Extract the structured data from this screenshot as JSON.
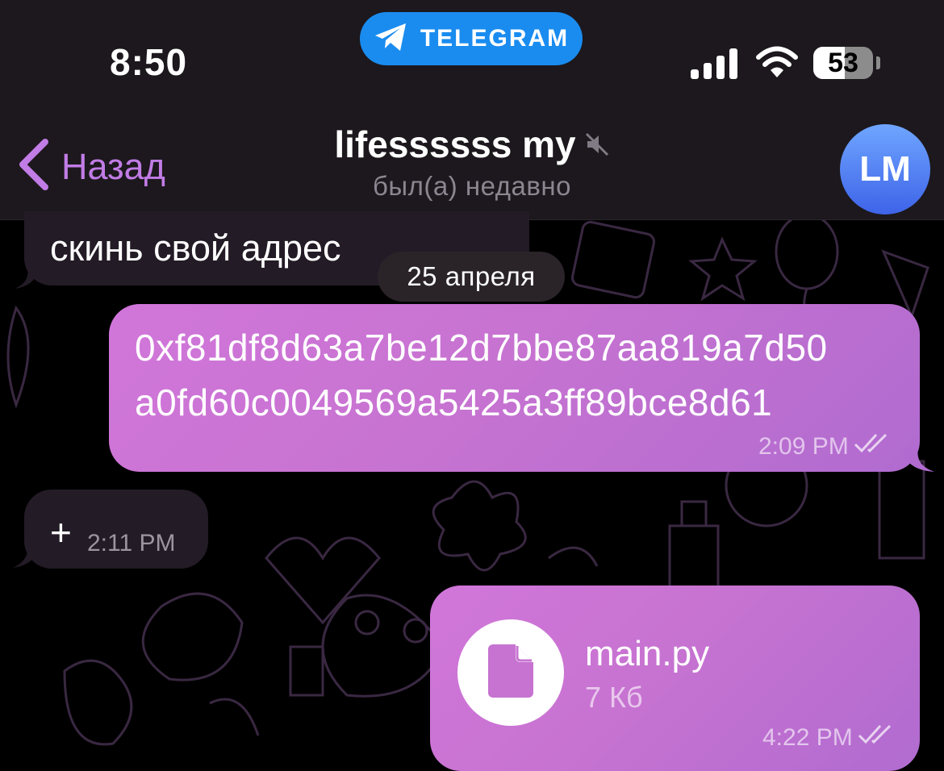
{
  "status_bar": {
    "time": "8:50",
    "app_pill_label": "TELEGRAM",
    "battery_percent": 53,
    "battery_label": "53"
  },
  "header": {
    "back_label": "Назад",
    "title": "lifessssss my",
    "subtitle": "был(а) недавно",
    "avatar_initials": "LM",
    "accent_color": "#c17ce5",
    "muted": true
  },
  "messages": {
    "m1": {
      "text": "скинь свой адрес",
      "direction": "incoming"
    },
    "date_separator": "25 апреля",
    "m2": {
      "line1": "0xf81df8d63a7be12d7bbe87aa819a7d50",
      "line2": "a0fd60c0049569a5425a3ff89bce8d61",
      "time": "2:09 PM",
      "direction": "outgoing",
      "read": true
    },
    "m3": {
      "text": "+",
      "time": "2:11 PM",
      "direction": "incoming"
    },
    "m4": {
      "file_name": "main.py",
      "file_size": "7 Кб",
      "time": "4:22 PM",
      "direction": "outgoing",
      "read": true
    }
  },
  "colors": {
    "outgoing_bubble": "#c773d1",
    "incoming_bubble": "#231b26",
    "header_bg": "#1c181d",
    "pill_blue": "#1a8cf0"
  }
}
